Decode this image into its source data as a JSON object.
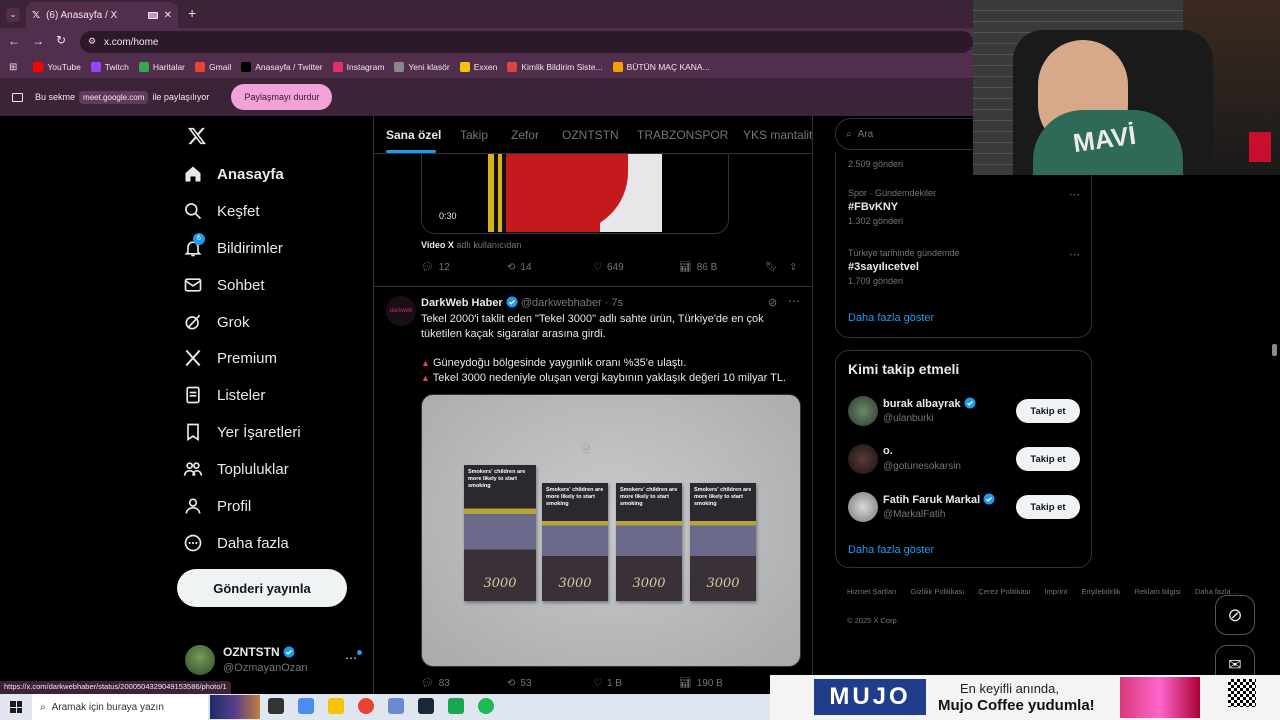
{
  "browser": {
    "tab_title": "(6) Anasayfa / X",
    "url": "x.com/home",
    "bookmarks": [
      {
        "label": "YouTube",
        "color": "#ff0000"
      },
      {
        "label": "Twitch",
        "color": "#9146ff"
      },
      {
        "label": "Haritalar",
        "color": "#34a853"
      },
      {
        "label": "Gmail",
        "color": "#ea4335"
      },
      {
        "label": "Anasayfa / Twitter",
        "color": "#000000"
      },
      {
        "label": "Instagram",
        "color": "#e1306c"
      },
      {
        "label": "Yeni klasör",
        "color": "#888888"
      },
      {
        "label": "Exxen",
        "color": "#f5c400"
      },
      {
        "label": "Kimlik Bildirim Siste...",
        "color": "#d44"
      },
      {
        "label": "BÜTÜN MAÇ KANA...",
        "color": "#f5a000"
      }
    ],
    "share_prefix": "Bu sekme",
    "share_domain": "meet.google.com",
    "share_suffix": "ile paylaşılıyor",
    "stop_share": "Paylaşmayı durdur",
    "status_url": "https://x.com/darkwebhaber/status/2000504329049153586/photo/1"
  },
  "nav": {
    "items": [
      {
        "label": "Anasayfa",
        "icon": "home-icon"
      },
      {
        "label": "Keşfet",
        "icon": "search-icon"
      },
      {
        "label": "Bildirimler",
        "icon": "bell-icon",
        "badge": "6"
      },
      {
        "label": "Sohbet",
        "icon": "mail-icon"
      },
      {
        "label": "Grok",
        "icon": "grok-icon"
      },
      {
        "label": "Premium",
        "icon": "x-icon"
      },
      {
        "label": "Listeler",
        "icon": "list-icon"
      },
      {
        "label": "Yer İşaretleri",
        "icon": "bookmark-icon"
      },
      {
        "label": "Topluluklar",
        "icon": "communities-icon"
      },
      {
        "label": "Profil",
        "icon": "profile-icon"
      },
      {
        "label": "Daha fazla",
        "icon": "more-icon"
      }
    ],
    "post_button": "Gönderi yayınla",
    "account_name": "OZNTSTN",
    "account_handle": "@OzmayanOzan"
  },
  "feed": {
    "tabs": [
      "Sana özel",
      "Takip",
      "Zefor",
      "OZNTSTN",
      "TRABZONSPOR",
      "YKS mantalite"
    ],
    "active_tab": "Sana özel",
    "video_post": {
      "duration": "0:30",
      "source_name": "Video X",
      "source_suffix": "adlı kullanıcıdan",
      "replies": "12",
      "reposts": "14",
      "likes": "649",
      "views": "86 B"
    },
    "post": {
      "author": "DarkWeb Haber",
      "handle": "@darkwebhaber",
      "time": "· 7s",
      "avatar_text": "darkweb",
      "text_1": "Tekel 2000'i taklit eden \"Tekel 3000\" adlı sahte ürün, Türkiye'de en çok tüketilen kaçak sigaralar arasına girdi.",
      "bullet_1": "Güneydoğu bölgesinde yaygınlık oranı %35'e ulaştı.",
      "bullet_2": "Tekel 3000 nedeniyle oluşan vergi kaybının yaklaşık değeri 10 milyar TL.",
      "pack_warning": "Smokers' children are more likely to start smoking",
      "pack_brand": "3000",
      "replies": "83",
      "reposts": "53",
      "likes": "1 B",
      "views": "190 B"
    }
  },
  "right": {
    "search_placeholder": "Ara",
    "trend_top_count": "2.509 gönderi",
    "trends": [
      {
        "category": "Spor · Gündemdekiler",
        "name": "#FBvKNY",
        "count": "1.302 gönderi"
      },
      {
        "category": "Türkiye tarihinde gündemde",
        "name": "#3sayılıcetvel",
        "count": "1.709 gönderi"
      }
    ],
    "show_more": "Daha fazla göster",
    "who_to_follow_title": "Kimi takip etmeli",
    "follow": [
      {
        "name": "burak albayrak",
        "handle": "@ulanburki",
        "verified": true,
        "button": "Takip et"
      },
      {
        "name": "o.",
        "handle": "@gotunesokarsin",
        "verified": false,
        "button": "Takip et"
      },
      {
        "name": "Fatih Faruk Markal",
        "handle": "@MarkalFatih",
        "verified": true,
        "button": "Takip et"
      }
    ],
    "footer_links": [
      "Hizmet Şartları",
      "Gizlilik Politikası",
      "Çerez Politikası",
      "Imprint",
      "Erişilebilirlik",
      "Reklam bilgisi",
      "Daha fazla ..."
    ],
    "copyright": "© 2025 X Corp."
  },
  "taskbar": {
    "search_placeholder": "Aramak için buraya yazın"
  },
  "overlay": {
    "webcam_text": "MAVİ",
    "ad_logo": "MUJO",
    "ad_line1": "En keyifli anında,",
    "ad_line2": "Mujo Coffee yudumla!"
  },
  "colors": {
    "accent": "#1d9bf0",
    "browser_frame": "#512f4c",
    "share_button": "#f2a2d6"
  }
}
